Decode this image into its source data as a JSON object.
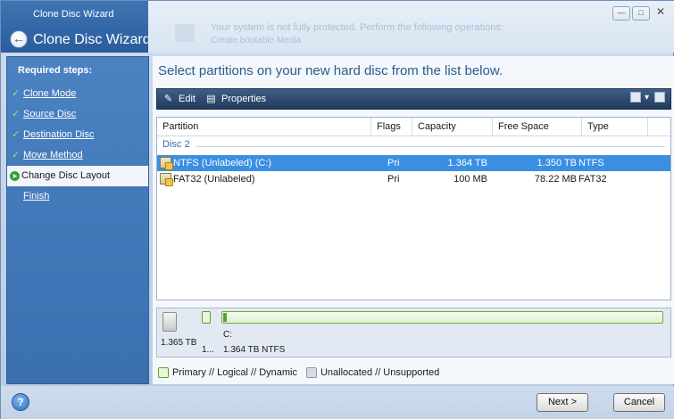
{
  "window": {
    "title_small": "Clone Disc Wizard",
    "title_big": "Clone Disc Wizard",
    "banner_text": "Your system is not fully protected. Perform the following operations:",
    "banner_link": "Create bootable Media"
  },
  "sidebar": {
    "heading": "Required steps:",
    "items": [
      {
        "label": "Clone Mode",
        "state": "done"
      },
      {
        "label": "Source Disc",
        "state": "done"
      },
      {
        "label": "Destination Disc",
        "state": "done"
      },
      {
        "label": "Move Method",
        "state": "done"
      },
      {
        "label": "Change Disc Layout",
        "state": "current"
      },
      {
        "label": "Finish",
        "state": "pending"
      }
    ]
  },
  "main": {
    "heading": "Select partitions on your new hard disc from the list below.",
    "toolbar": {
      "edit": "Edit",
      "properties": "Properties"
    },
    "columns": [
      "Partition",
      "Flags",
      "Capacity",
      "Free Space",
      "Type"
    ],
    "group": "Disc 2",
    "rows": [
      {
        "partition": "NTFS (Unlabeled) (C:)",
        "flags": "Pri",
        "capacity": "1.364 TB",
        "free": "1.350 TB",
        "type": "NTFS",
        "selected": true
      },
      {
        "partition": "FAT32 (Unlabeled)",
        "flags": "Pri",
        "capacity": "100 MB",
        "free": "78.22 MB",
        "type": "FAT32",
        "selected": false
      }
    ],
    "diskmap": {
      "disk_size": "1.365 TB",
      "small_part_label": "1...",
      "main_part_letter": "C:",
      "main_part_info": "1.364 TB  NTFS"
    },
    "legend": {
      "primary": "Primary // Logical // Dynamic",
      "unallocated": "Unallocated // Unsupported"
    }
  },
  "footer": {
    "next": "Next >",
    "cancel": "Cancel"
  }
}
